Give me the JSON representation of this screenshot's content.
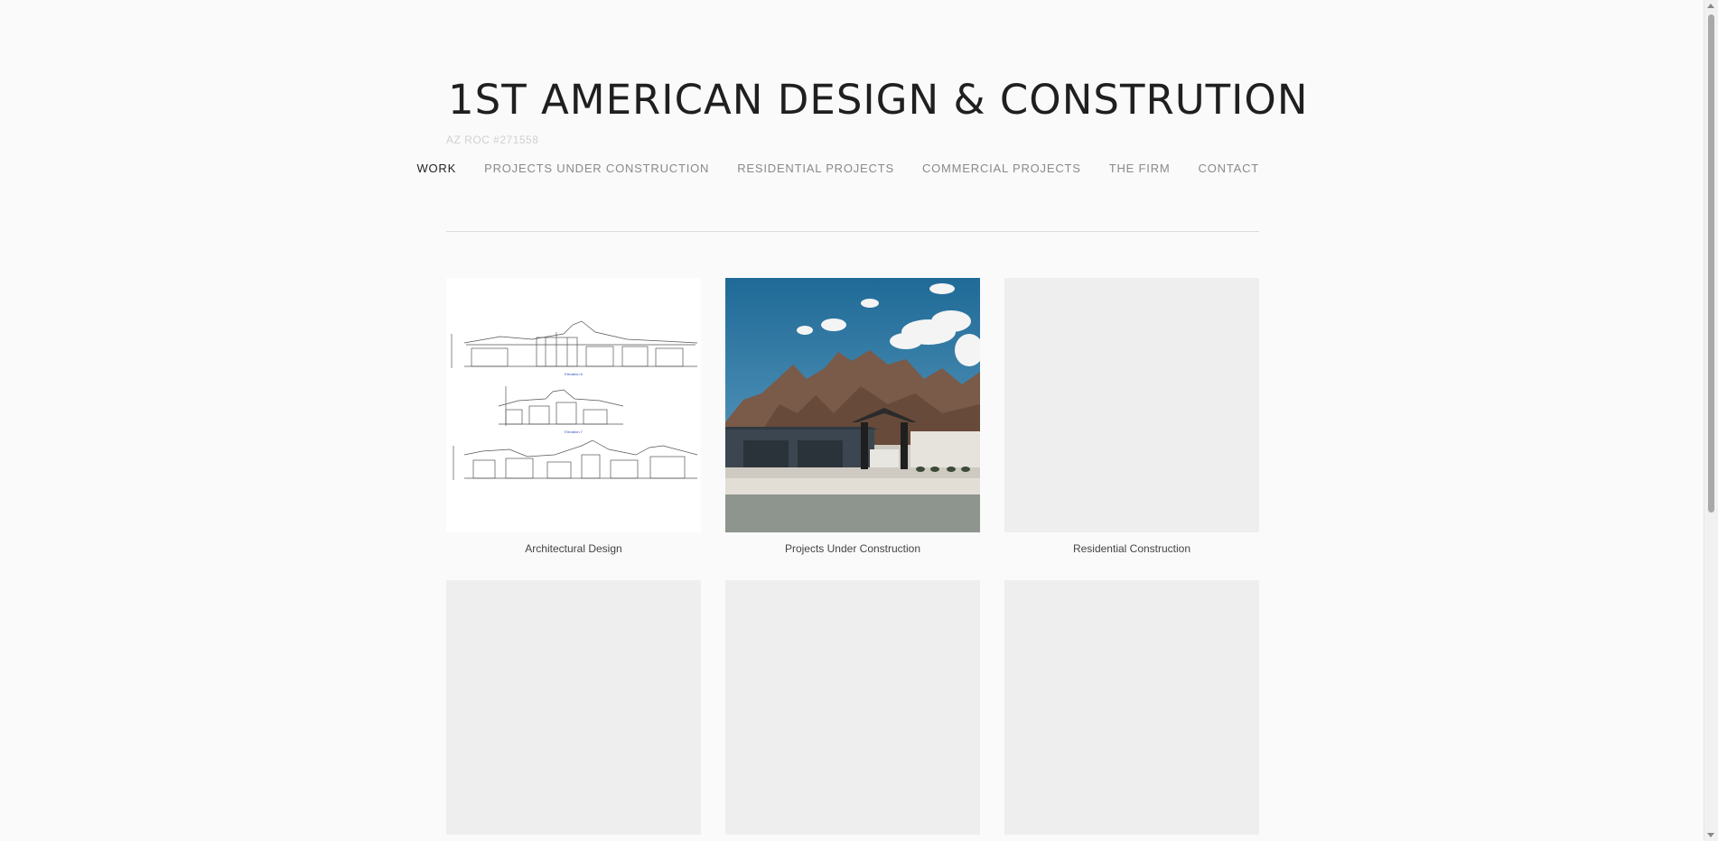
{
  "site": {
    "title": "1ST AMERICAN DESIGN & CONSTRUTION",
    "tagline": "AZ ROC #271558"
  },
  "nav": {
    "items": [
      {
        "label": "WORK",
        "active": true
      },
      {
        "label": "PROJECTS UNDER CONSTRUCTION",
        "active": false
      },
      {
        "label": "RESIDENTIAL PROJECTS",
        "active": false
      },
      {
        "label": "COMMERCIAL PROJECTS",
        "active": false
      },
      {
        "label": "THE FIRM",
        "active": false
      },
      {
        "label": "CONTACT",
        "active": false
      }
    ]
  },
  "gallery": {
    "tiles": [
      {
        "caption": "Architectural Design",
        "thumbnail": "elevation-drawing"
      },
      {
        "caption": "Projects Under Construction",
        "thumbnail": "house-mountain-photo"
      },
      {
        "caption": "Residential Construction",
        "thumbnail": "placeholder"
      },
      {
        "caption": "",
        "thumbnail": "placeholder"
      },
      {
        "caption": "",
        "thumbnail": "placeholder"
      },
      {
        "caption": "",
        "thumbnail": "placeholder"
      }
    ]
  },
  "colors": {
    "background": "#fafafa",
    "placeholder": "#eeeeee",
    "nav_active": "#222222",
    "nav_inactive": "#8a8a8a"
  }
}
